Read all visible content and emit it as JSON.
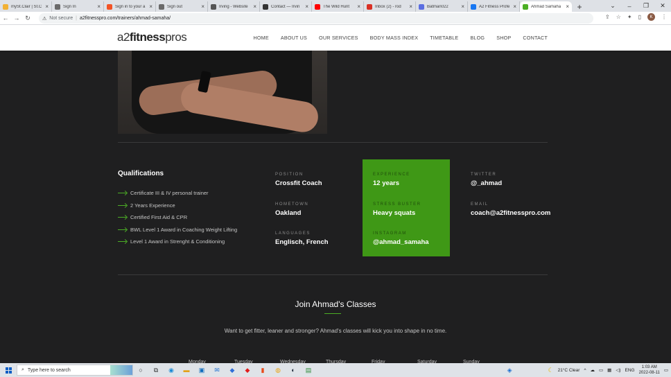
{
  "browser": {
    "tabs": [
      {
        "title": "mySt.Clair | St.C",
        "color": "#f2b134"
      },
      {
        "title": "Sign In",
        "color": "#6a6a6a"
      },
      {
        "title": "Sign in to your a",
        "color": "#f35325"
      },
      {
        "title": "Sign out",
        "color": "#6a6a6a"
      },
      {
        "title": "Irving - Website",
        "color": "#555"
      },
      {
        "title": "Contact — Irvin",
        "color": "#333"
      },
      {
        "title": "The Wild Hunt",
        "color": "#ff0000"
      },
      {
        "title": "Inbox (2) - rod",
        "color": "#d93025"
      },
      {
        "title": "Batman022",
        "color": "#5b6ee1"
      },
      {
        "title": "A2 Fitness Profe",
        "color": "#1877f2"
      },
      {
        "title": "Ahmad Samaha",
        "color": "#4caf25"
      }
    ],
    "not_secure": "Not secure",
    "url": "a2fitnesspro.com/trainers/ahmad-samaha/",
    "profile_initial": "K"
  },
  "site": {
    "logo_light": "a2",
    "logo_bold": "fitness",
    "logo_tail": "pros",
    "menu": [
      "HOME",
      "ABOUT US",
      "OUR SERVICES",
      "BODY MASS INDEX",
      "TIMETABLE",
      "BLOG",
      "SHOP",
      "CONTACT"
    ]
  },
  "qualifications": {
    "title": "Qualifications",
    "items": [
      "Certificate III & IV personal trainer",
      "2 Years Experience",
      "Certified First Aid & CPR",
      "BWL Level 1 Award in Coaching Weight Lifting",
      "Level 1 Award in Strenght & Conditioning"
    ]
  },
  "profile": {
    "position_label": "POSITION",
    "position": "Crossfit Coach",
    "hometown_label": "HOMETOWN",
    "hometown": "Oakland",
    "languages_label": "LANGUAGES",
    "languages": "Englisch, French",
    "experience_label": "EXPERIENCE",
    "experience": "12 years",
    "stress_label": "STRESS BUSTER",
    "stress": "Heavy squats",
    "instagram_label": "INSTAGRAM",
    "instagram": "@ahmad_samaha",
    "twitter_label": "TWITTER",
    "twitter": "@_ahmad",
    "email_label": "EMAIL",
    "email": "coach@a2fitnesspro.com"
  },
  "classes": {
    "title": "Join Ahmad's Classes",
    "intro": "Want to get fitter, leaner and stronger? Ahmad's classes will kick you into shape in no time.",
    "days": [
      "Monday",
      "Tuesday",
      "Wednesday",
      "Thursday",
      "Friday",
      "Saturday",
      "Sunday"
    ]
  },
  "taskbar": {
    "search_placeholder": "Type here to search",
    "weather": "21°C  Clear",
    "lang": "ENG",
    "time": "1:03 AM",
    "date": "2022-08-11"
  }
}
